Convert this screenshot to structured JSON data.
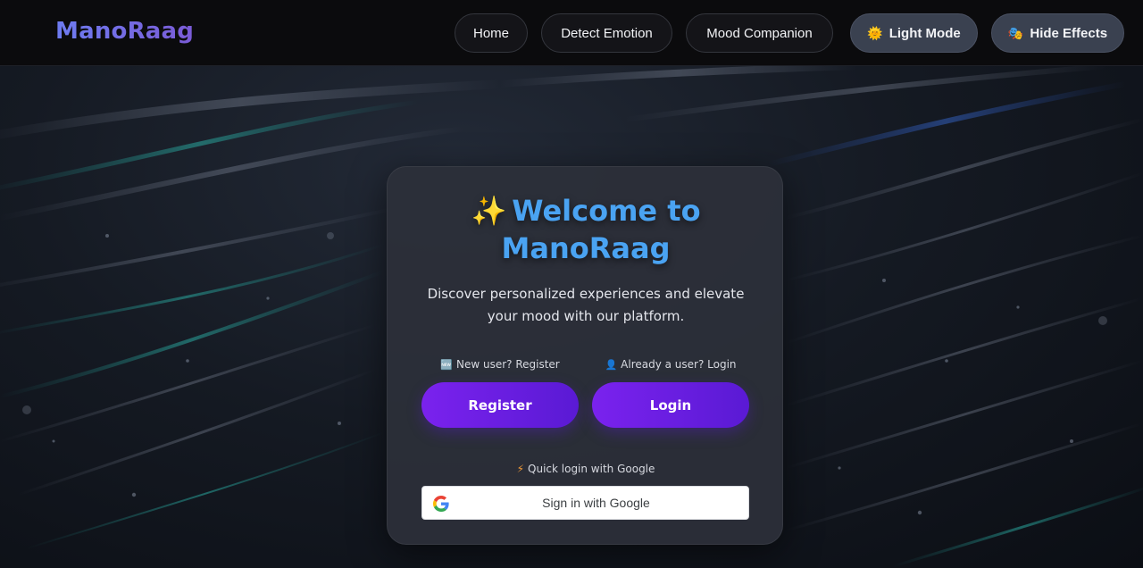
{
  "app": {
    "brand": "ManoRaag"
  },
  "nav": {
    "home": "Home",
    "detect_emotion": "Detect Emotion",
    "mood_companion": "Mood Companion",
    "light_mode": "Light Mode",
    "light_mode_icon": "🌞",
    "hide_effects": "Hide Effects",
    "hide_effects_icon": "🎭"
  },
  "welcome": {
    "sparkle": "✨",
    "title_line1": "Welcome to",
    "title_line2": "ManoRaag",
    "subtitle": "Discover personalized experiences and elevate your mood with our platform."
  },
  "auth": {
    "register_hint_icon": "🆕",
    "register_hint": "New user? Register",
    "login_hint_icon": "👤",
    "login_hint": "Already a user? Login",
    "register_label": "Register",
    "login_label": "Login",
    "google_hint_icon": "⚡",
    "google_hint": "Quick login with Google",
    "google_button_label": "Sign in with Google"
  },
  "colors": {
    "accent_purple": "#7a22ee",
    "title_blue": "#4aa3f2",
    "brand_gradient_start": "#6e7cf0",
    "brand_gradient_end": "#7a5bd6"
  }
}
